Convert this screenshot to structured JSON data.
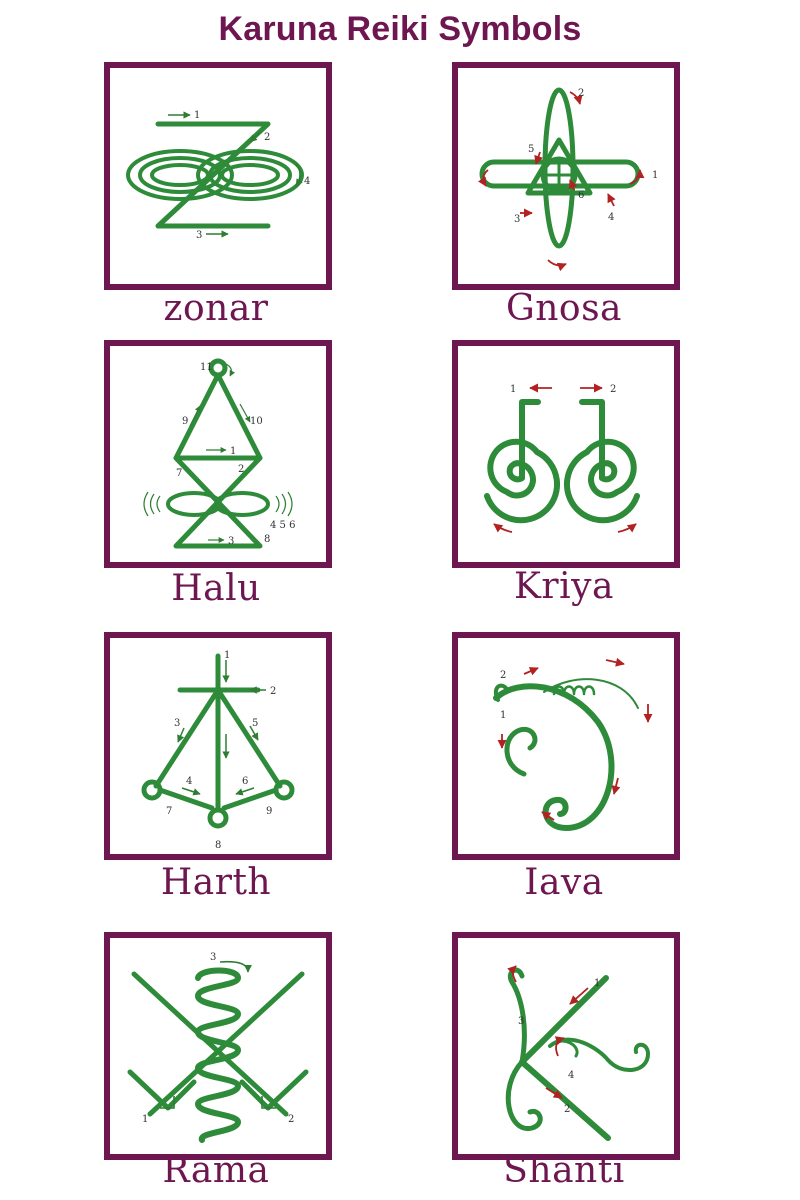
{
  "title": "Karuna Reiki Symbols",
  "colors": {
    "frame": "#6e1650",
    "symbol_green": "#2e8b3a",
    "arrow_red": "#b22222"
  },
  "symbols": [
    {
      "name": "zonar",
      "icon": "zonar-symbol-icon",
      "step_numbers": [
        "1",
        "2",
        "3",
        "4"
      ]
    },
    {
      "name": "Gnosa",
      "icon": "gnosa-symbol-icon",
      "step_numbers": [
        "1",
        "2",
        "3",
        "4",
        "5",
        "6"
      ]
    },
    {
      "name": "Halu",
      "icon": "halu-symbol-icon",
      "step_numbers": [
        "1",
        "2",
        "3",
        "4 5 6",
        "7",
        "8",
        "9",
        "10",
        "11"
      ]
    },
    {
      "name": "Kriya",
      "icon": "kriya-symbol-icon",
      "step_numbers": [
        "1",
        "2"
      ]
    },
    {
      "name": "Harth",
      "icon": "harth-symbol-icon",
      "step_numbers": [
        "1",
        "2",
        "3",
        "4",
        "5",
        "6",
        "7",
        "8",
        "9"
      ]
    },
    {
      "name": "Iava",
      "icon": "iava-symbol-icon",
      "step_numbers": [
        "1",
        "2"
      ]
    },
    {
      "name": "Rama",
      "icon": "rama-symbol-icon",
      "step_numbers": [
        "1",
        "2",
        "3"
      ]
    },
    {
      "name": "Shanti",
      "icon": "shanti-symbol-icon",
      "step_numbers": [
        "1",
        "2",
        "3",
        "4"
      ]
    }
  ]
}
